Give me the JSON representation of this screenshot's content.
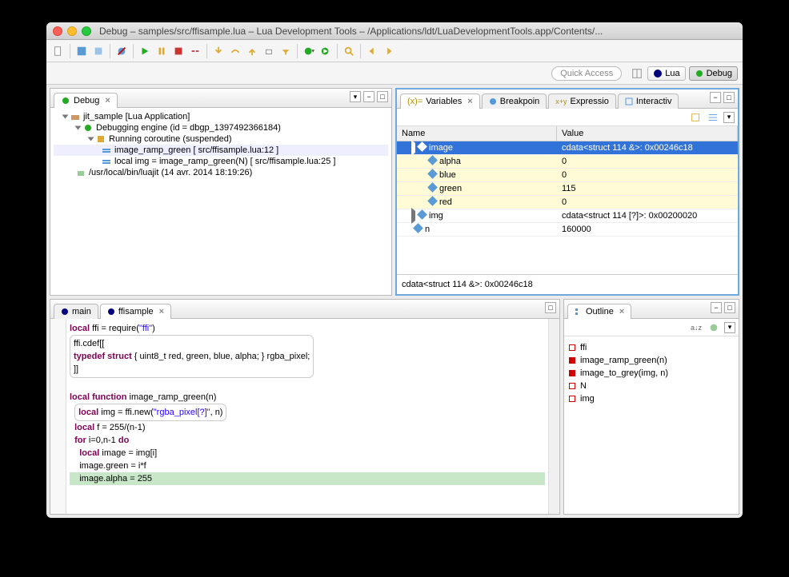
{
  "window": {
    "title": "Debug – samples/src/ffisample.lua – Lua Development Tools – /Applications/ldt/LuaDevelopmentTools.app/Contents/..."
  },
  "quick_access": "Quick Access",
  "perspectives": {
    "lua": "Lua",
    "debug": "Debug"
  },
  "debug_view": {
    "tab": "Debug",
    "tree": {
      "root": "jit_sample [Lua Application]",
      "engine": "Debugging engine (id = dbgp_1397492366184)",
      "coroutine": "Running coroutine (suspended)",
      "frame1": "image_ramp_green  [ src/ffisample.lua:12 ]",
      "frame2": "local img = image_ramp_green(N)  [ src/ffisample.lua:25 ]",
      "process": "/usr/local/bin/luajit (14 avr. 2014 18:19:26)"
    }
  },
  "variables_view": {
    "tab": "Variables",
    "tab_breakpoints": "Breakpoin",
    "tab_expressions": "Expressio",
    "tab_interactive": "Interactiv",
    "name_header": "Name",
    "value_header": "Value",
    "rows": {
      "image": {
        "name": "image",
        "value": "cdata<struct 114 &>: 0x00246c18"
      },
      "alpha": {
        "name": "alpha",
        "value": "0"
      },
      "blue": {
        "name": "blue",
        "value": "0"
      },
      "green": {
        "name": "green",
        "value": "115"
      },
      "red": {
        "name": "red",
        "value": "0"
      },
      "img": {
        "name": "img",
        "value": "cdata<struct 114 [?]>: 0x00200020"
      },
      "n": {
        "name": "n",
        "value": "160000"
      }
    },
    "detail": "cdata<struct 114 &>: 0x00246c18"
  },
  "editor": {
    "tab_main": "main",
    "tab_ffisample": "ffisample"
  },
  "outline": {
    "tab": "Outline",
    "items": {
      "ffi": "ffi",
      "ramp": "image_ramp_green(n)",
      "grey": "image_to_grey(img, n)",
      "N": "N",
      "img": "img"
    }
  }
}
